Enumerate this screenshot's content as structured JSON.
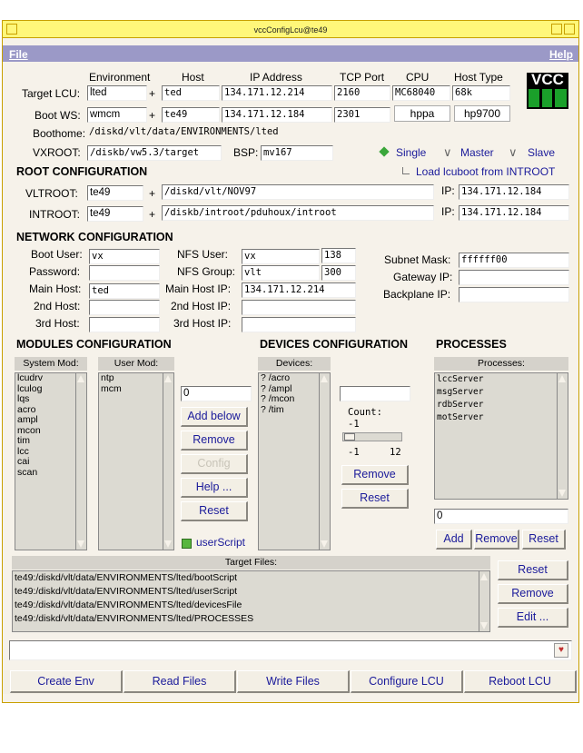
{
  "window": {
    "title": "vccConfigLcu@te49"
  },
  "menu": {
    "file": "File",
    "help": "Help"
  },
  "logo": {
    "text": "VCC"
  },
  "top": {
    "col_headers": {
      "environment": "Environment",
      "host": "Host",
      "ip": "IP Address",
      "port": "TCP Port",
      "cpu": "CPU",
      "host_type": "Host Type"
    },
    "target_lcu": {
      "label": "Target LCU:",
      "env": "lted",
      "host": "ted",
      "ip": "134.171.12.214",
      "port": "2160",
      "cpu": "MC68040",
      "host_type": "68k"
    },
    "boot_ws": {
      "label": "Boot WS:",
      "env": "wmcm",
      "host": "te49",
      "ip": "134.171.12.184",
      "port": "2301",
      "cpu": "hppa",
      "host_type": "hp9700"
    },
    "plus": "+",
    "boothome": {
      "label": "Boothome:",
      "value": "/diskd/vlt/data/ENVIRONMENTS/lted"
    },
    "vxroot": {
      "label": "VXROOT:",
      "value": "/diskb/vw5.3/target"
    },
    "bsp": {
      "label": "BSP:",
      "value": "mv167"
    },
    "mode": {
      "single": "Single",
      "master": "Master",
      "slave": "Slave",
      "selected": "Single"
    }
  },
  "root": {
    "title": "ROOT CONFIGURATION",
    "load_label": "Load lcuboot from INTROOT",
    "vltroot": {
      "label": "VLTROOT:",
      "host": "te49",
      "path": "/diskd/vlt/NOV97",
      "ip_label": "IP:",
      "ip": "134.171.12.184"
    },
    "introot": {
      "label": "INTROOT:",
      "host": "te49",
      "path": "/diskb/introot/pduhoux/introot",
      "ip_label": "IP:",
      "ip": "134.171.12.184"
    }
  },
  "network": {
    "title": "NETWORK CONFIGURATION",
    "boot_user": {
      "label": "Boot User:",
      "value": "vx"
    },
    "password": {
      "label": "Password:",
      "value": ""
    },
    "main_host": {
      "label": "Main Host:",
      "value": "ted"
    },
    "second_host": {
      "label": "2nd Host:",
      "value": ""
    },
    "third_host": {
      "label": "3rd Host:",
      "value": ""
    },
    "nfs_user": {
      "label": "NFS User:",
      "value": "vx",
      "id": "138"
    },
    "nfs_group": {
      "label": "NFS Group:",
      "value": "vlt",
      "id": "300"
    },
    "main_host_ip": {
      "label": "Main Host IP:",
      "value": "134.171.12.214"
    },
    "second_host_ip": {
      "label": "2nd Host IP:",
      "value": ""
    },
    "third_host_ip": {
      "label": "3rd Host IP:",
      "value": ""
    },
    "subnet": {
      "label": "Subnet Mask:",
      "value": "ffffff00"
    },
    "gateway": {
      "label": "Gateway IP:",
      "value": ""
    },
    "backplane": {
      "label": "Backplane IP:",
      "value": ""
    }
  },
  "modules": {
    "title": "MODULES CONFIGURATION",
    "system_header": "System Mod:",
    "system_items": [
      "lcudrv",
      "lculog",
      "lqs",
      "acro",
      "ampl",
      "mcon",
      "tim",
      "lcc",
      "cai",
      "scan"
    ],
    "user_header": "User Mod:",
    "user_items": [
      "ntp",
      "mcm"
    ],
    "input_value": "0",
    "add_below": "Add below",
    "remove": "Remove",
    "config": "Config",
    "help": "Help ...",
    "reset": "Reset",
    "user_script": "userScript"
  },
  "devices": {
    "title": "DEVICES CONFIGURATION",
    "header": "Devices:",
    "items": [
      "? /acro",
      "? /ampl",
      "? /mcon",
      "? /tim"
    ],
    "input_value": "",
    "count_label": "Count:",
    "count_value": "-1",
    "count_min": "-1",
    "count_max": "12",
    "remove": "Remove",
    "reset": "Reset"
  },
  "processes": {
    "title": "PROCESSES",
    "header": "Processes:",
    "items": [
      "lccServer",
      "msgServer",
      "rdbServer",
      "motServer"
    ],
    "input_value": "0",
    "add": "Add",
    "remove": "Remove",
    "reset": "Reset"
  },
  "target_files": {
    "header": "Target Files:",
    "items": [
      "te49:/diskd/vlt/data/ENVIRONMENTS/lted/bootScript",
      "te49:/diskd/vlt/data/ENVIRONMENTS/lted/userScript",
      "te49:/diskd/vlt/data/ENVIRONMENTS/lted/devicesFile",
      "te49:/diskd/vlt/data/ENVIRONMENTS/lted/PROCESSES"
    ],
    "reset": "Reset",
    "remove": "Remove",
    "edit": "Edit ..."
  },
  "status": {
    "value": ""
  },
  "actions": {
    "create_env": "Create Env",
    "read_files": "Read Files",
    "write_files": "Write Files",
    "configure_lcu": "Configure LCU",
    "reboot_lcu": "Reboot LCU"
  },
  "colors": {
    "titlebar": "#fff77a",
    "menubar": "#9b99c7",
    "button_text": "#1a1a9a",
    "diamond_on": "#3aa63a",
    "indicator": "#57b63e"
  }
}
